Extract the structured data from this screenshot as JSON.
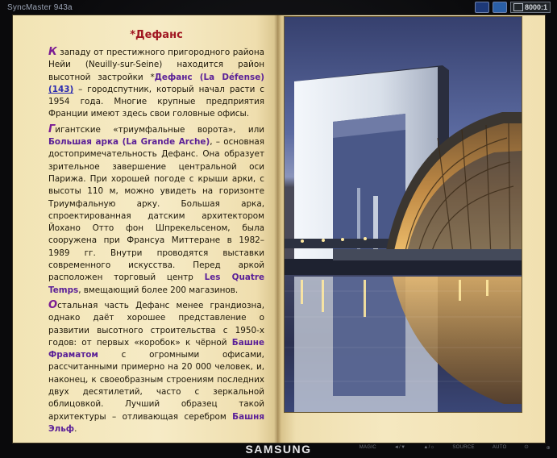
{
  "monitor": {
    "model_label": "SyncMaster 943a",
    "brand": "SAMSUNG",
    "contrast_badge": "8000:1",
    "badge_icons": [
      "low-emission-badge-icon",
      "energy-star-badge-icon",
      "contrast-ratio-badge-icon"
    ],
    "buttons": [
      "MAGIC",
      "◄/▼",
      "▲/☼",
      "SOURCE",
      "AUTO",
      "⏻",
      "⊕"
    ]
  },
  "book": {
    "title": "*Дефанс",
    "paragraphs": [
      {
        "dropcap": "К",
        "segments": [
          {
            "text": " западу от престижного пригородного района Нейи (Neuilly-sur-Seine) находится район высотной застройки *",
            "style": "plain"
          },
          {
            "text": "Дефанс (La Défense)",
            "style": "link"
          },
          {
            "text": " ",
            "style": "plain"
          },
          {
            "text": "(143)",
            "style": "link-underlined"
          },
          {
            "text": " – городспутник, который начал расти с 1954 года. Многие крупные предприятия Франции имеют здесь свои головные офисы.",
            "style": "plain"
          }
        ]
      },
      {
        "dropcap": "Г",
        "segments": [
          {
            "text": "игантские «триумфальные ворота», или ",
            "style": "plain"
          },
          {
            "text": "Большая арка (La Grande Arche)",
            "style": "link"
          },
          {
            "text": ", – основная достопримечательность Дефанс. Она образует зрительное завершение центральной оси Парижа. При хорошей погоде с крыши арки, с высоты 110 м, можно увидеть на горизонте Триумфальную арку. Большая арка, спроектированная датским архитектором Йохано Отто фон Шпрекельсеном, была сооружена при Франсуа Миттеране в 1982–1989 гг. Внутри проводятся выставки современного искусства. Перед аркой расположен торговый центр ",
            "style": "plain"
          },
          {
            "text": "Les Quatre Temps",
            "style": "link"
          },
          {
            "text": ", вмещающий более 200 магазинов.",
            "style": "plain"
          }
        ]
      },
      {
        "dropcap": "О",
        "segments": [
          {
            "text": "стальная часть Дефанс менее грандиозна, однако даёт хорошее представление о развитии высотного строительства с 1950-х годов: от первых «коробок» к чёрной ",
            "style": "plain"
          },
          {
            "text": "Башне Фраматом",
            "style": "link"
          },
          {
            "text": " с огромными офисами, рассчитанными примерно на 20 000 человек, и, наконец, к своеобразным строениям последних двух десятилетий, часто с зеркальной облицовкой. Лучший образец такой архитектуры – отливающая серебром ",
            "style": "plain"
          },
          {
            "text": "Башня Эльф",
            "style": "link"
          },
          {
            "text": ".",
            "style": "plain"
          }
        ]
      }
    ]
  },
  "colors": {
    "page": "#f4e7bc",
    "title": "#a01620",
    "link": "#5a1f97",
    "dropcap": "#7a1c93"
  }
}
